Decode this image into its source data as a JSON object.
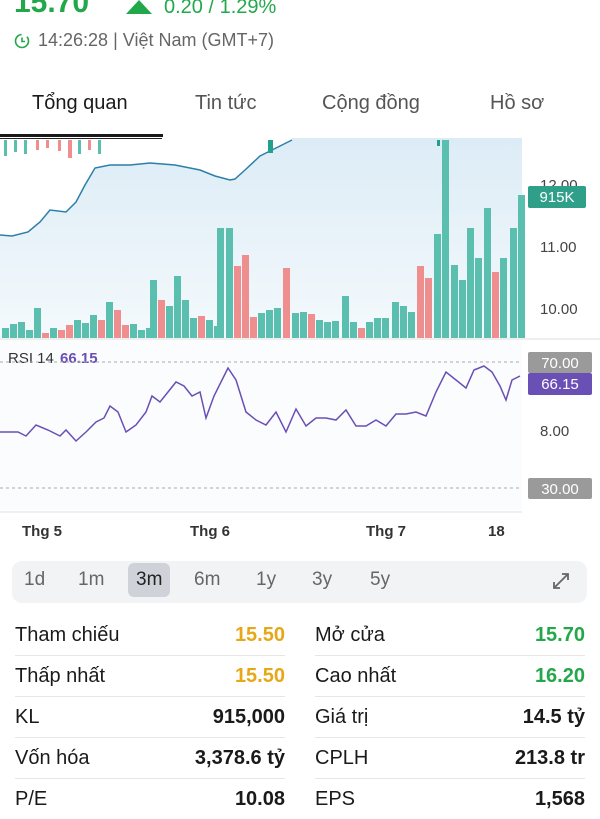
{
  "header": {
    "price": "15.70",
    "change": "0.20 / 1.29%",
    "time": "14:26:28",
    "timezone": "Việt Nam (GMT+7)"
  },
  "tabs": [
    {
      "label": "Tổng quan",
      "active": true
    },
    {
      "label": "Tin tức",
      "active": false
    },
    {
      "label": "Cộng đồng",
      "active": false
    },
    {
      "label": "Hồ sơ",
      "active": false
    }
  ],
  "chart_data": {
    "type": "bar",
    "price_axis": {
      "ticks": [
        "12.00",
        "11.00",
        "10.00",
        "8.00"
      ]
    },
    "volume_badge": "915K",
    "line_series": [
      [
        0,
        235
      ],
      [
        12,
        236
      ],
      [
        28,
        232
      ],
      [
        40,
        222
      ],
      [
        50,
        210
      ],
      [
        66,
        212
      ],
      [
        76,
        202
      ],
      [
        85,
        185
      ],
      [
        95,
        168
      ],
      [
        110,
        165
      ],
      [
        130,
        165
      ],
      [
        150,
        163
      ],
      [
        175,
        165
      ],
      [
        200,
        170
      ],
      [
        215,
        176
      ],
      [
        230,
        180
      ],
      [
        235,
        179
      ],
      [
        245,
        170
      ],
      [
        260,
        156
      ],
      [
        280,
        146
      ],
      [
        292,
        140
      ]
    ],
    "volume_bars": [
      {
        "x": 2,
        "top": 328,
        "color": "#5bbfb0"
      },
      {
        "x": 10,
        "top": 324,
        "color": "#5bbfb0"
      },
      {
        "x": 18,
        "top": 322,
        "color": "#5bbfb0"
      },
      {
        "x": 26,
        "top": 330,
        "color": "#5bbfb0"
      },
      {
        "x": 34,
        "top": 308,
        "color": "#5bbfb0"
      },
      {
        "x": 42,
        "top": 333,
        "color": "#ef8e8e"
      },
      {
        "x": 50,
        "top": 328,
        "color": "#5bbfb0"
      },
      {
        "x": 58,
        "top": 330,
        "color": "#ef8e8e"
      },
      {
        "x": 66,
        "top": 325,
        "color": "#ef8e8e"
      },
      {
        "x": 74,
        "top": 320,
        "color": "#5bbfb0"
      },
      {
        "x": 82,
        "top": 323,
        "color": "#5bbfb0"
      },
      {
        "x": 90,
        "top": 315,
        "color": "#5bbfb0"
      },
      {
        "x": 98,
        "top": 320,
        "color": "#ef8e8e"
      },
      {
        "x": 106,
        "top": 302,
        "color": "#5bbfb0"
      },
      {
        "x": 114,
        "top": 310,
        "color": "#ef8e8e"
      },
      {
        "x": 122,
        "top": 325,
        "color": "#ef8e8e"
      },
      {
        "x": 130,
        "top": 324,
        "color": "#5bbfb0"
      },
      {
        "x": 138,
        "top": 330,
        "color": "#5bbfb0"
      },
      {
        "x": 146,
        "top": 328,
        "color": "#5bbfb0"
      },
      {
        "x": 150,
        "top": 280,
        "color": "#5bbfb0"
      },
      {
        "x": 158,
        "top": 300,
        "color": "#ef8e8e"
      },
      {
        "x": 166,
        "top": 306,
        "color": "#5bbfb0"
      },
      {
        "x": 174,
        "top": 276,
        "color": "#5bbfb0"
      },
      {
        "x": 182,
        "top": 300,
        "color": "#5bbfb0"
      },
      {
        "x": 190,
        "top": 318,
        "color": "#5bbfb0"
      },
      {
        "x": 198,
        "top": 316,
        "color": "#ef8e8e"
      },
      {
        "x": 206,
        "top": 320,
        "color": "#5bbfb0"
      },
      {
        "x": 214,
        "top": 326,
        "color": "#5bbfb0"
      },
      {
        "x": 217,
        "top": 228,
        "color": "#5bbfb0"
      },
      {
        "x": 226,
        "top": 228,
        "color": "#5bbfb0"
      },
      {
        "x": 234,
        "top": 266,
        "color": "#ef8e8e"
      },
      {
        "x": 242,
        "top": 255,
        "color": "#ef8e8e"
      },
      {
        "x": 250,
        "top": 317,
        "color": "#ef8e8e"
      },
      {
        "x": 258,
        "top": 313,
        "color": "#5bbfb0"
      },
      {
        "x": 266,
        "top": 310,
        "color": "#5bbfb0"
      },
      {
        "x": 274,
        "top": 308,
        "color": "#5bbfb0"
      },
      {
        "x": 283,
        "top": 268,
        "color": "#ef8e8e"
      },
      {
        "x": 292,
        "top": 313,
        "color": "#5bbfb0"
      },
      {
        "x": 300,
        "top": 312,
        "color": "#5bbfb0"
      },
      {
        "x": 308,
        "top": 314,
        "color": "#ef8e8e"
      },
      {
        "x": 316,
        "top": 320,
        "color": "#5bbfb0"
      },
      {
        "x": 324,
        "top": 322,
        "color": "#5bbfb0"
      },
      {
        "x": 332,
        "top": 321,
        "color": "#5bbfb0"
      },
      {
        "x": 342,
        "top": 296,
        "color": "#5bbfb0"
      },
      {
        "x": 350,
        "top": 322,
        "color": "#5bbfb0"
      },
      {
        "x": 358,
        "top": 328,
        "color": "#ef8e8e"
      },
      {
        "x": 366,
        "top": 322,
        "color": "#5bbfb0"
      },
      {
        "x": 374,
        "top": 318,
        "color": "#5bbfb0"
      },
      {
        "x": 382,
        "top": 318,
        "color": "#5bbfb0"
      },
      {
        "x": 392,
        "top": 302,
        "color": "#5bbfb0"
      },
      {
        "x": 400,
        "top": 306,
        "color": "#5bbfb0"
      },
      {
        "x": 408,
        "top": 312,
        "color": "#5bbfb0"
      },
      {
        "x": 417,
        "top": 266,
        "color": "#ef8e8e"
      },
      {
        "x": 425,
        "top": 278,
        "color": "#ef8e8e"
      },
      {
        "x": 434,
        "top": 234,
        "color": "#5bbfb0"
      },
      {
        "x": 442,
        "top": 140,
        "color": "#5bbfb0"
      },
      {
        "x": 451,
        "top": 265,
        "color": "#5bbfb0"
      },
      {
        "x": 459,
        "top": 280,
        "color": "#5bbfb0"
      },
      {
        "x": 467,
        "top": 228,
        "color": "#5bbfb0"
      },
      {
        "x": 475,
        "top": 258,
        "color": "#5bbfb0"
      },
      {
        "x": 484,
        "top": 208,
        "color": "#5bbfb0"
      },
      {
        "x": 492,
        "top": 272,
        "color": "#ef8e8e"
      },
      {
        "x": 500,
        "top": 258,
        "color": "#5bbfb0"
      },
      {
        "x": 510,
        "top": 228,
        "color": "#5bbfb0"
      },
      {
        "x": 518,
        "top": 195,
        "color": "#5bbfb0"
      }
    ],
    "rsi": {
      "label": "RSI 14",
      "value": "66.15",
      "overbought": "70.00",
      "oversold": "30.00",
      "series": [
        [
          0,
          432
        ],
        [
          18,
          432
        ],
        [
          26,
          436
        ],
        [
          36,
          425
        ],
        [
          48,
          430
        ],
        [
          60,
          436
        ],
        [
          66,
          430
        ],
        [
          76,
          441
        ],
        [
          86,
          432
        ],
        [
          96,
          422
        ],
        [
          104,
          418
        ],
        [
          110,
          406
        ],
        [
          118,
          412
        ],
        [
          126,
          432
        ],
        [
          136,
          425
        ],
        [
          146,
          412
        ],
        [
          152,
          396
        ],
        [
          160,
          402
        ],
        [
          168,
          392
        ],
        [
          176,
          382
        ],
        [
          184,
          386
        ],
        [
          192,
          396
        ],
        [
          200,
          392
        ],
        [
          206,
          418
        ],
        [
          214,
          396
        ],
        [
          222,
          380
        ],
        [
          228,
          368
        ],
        [
          236,
          380
        ],
        [
          246,
          412
        ],
        [
          256,
          420
        ],
        [
          266,
          425
        ],
        [
          276,
          412
        ],
        [
          286,
          432
        ],
        [
          296,
          409
        ],
        [
          306,
          426
        ],
        [
          316,
          418
        ],
        [
          326,
          418
        ],
        [
          336,
          420
        ],
        [
          346,
          410
        ],
        [
          356,
          426
        ],
        [
          366,
          426
        ],
        [
          376,
          420
        ],
        [
          386,
          426
        ],
        [
          396,
          414
        ],
        [
          406,
          414
        ],
        [
          416,
          412
        ],
        [
          426,
          416
        ],
        [
          436,
          392
        ],
        [
          446,
          372
        ],
        [
          456,
          380
        ],
        [
          466,
          388
        ],
        [
          474,
          370
        ],
        [
          484,
          366
        ],
        [
          492,
          372
        ],
        [
          500,
          386
        ],
        [
          506,
          400
        ],
        [
          512,
          380
        ],
        [
          520,
          376
        ]
      ]
    },
    "x_ticks": [
      "Thg 5",
      "Thg 6",
      "Thg 7",
      "18"
    ]
  },
  "range": {
    "options": [
      "1d",
      "1m",
      "3m",
      "6m",
      "1y",
      "3y",
      "5y"
    ],
    "selected": "3m"
  },
  "stats": {
    "left": [
      {
        "label": "Tham chiếu",
        "value": "15.50",
        "color": "#e6a817"
      },
      {
        "label": "Thấp nhất",
        "value": "15.50",
        "color": "#e6a817"
      },
      {
        "label": "KL",
        "value": "915,000",
        "color": "#1a1a1a"
      },
      {
        "label": "Vốn hóa",
        "value": "3,378.6 tỷ",
        "color": "#1a1a1a"
      },
      {
        "label": "P/E",
        "value": "10.08",
        "color": "#1a1a1a"
      }
    ],
    "right": [
      {
        "label": "Mở cửa",
        "value": "15.70",
        "color": "#22a84a"
      },
      {
        "label": "Cao nhất",
        "value": "16.20",
        "color": "#22a84a"
      },
      {
        "label": "Giá trị",
        "value": "14.5 tỷ",
        "color": "#1a1a1a"
      },
      {
        "label": "CPLH",
        "value": "213.8 tr",
        "color": "#1a1a1a"
      },
      {
        "label": "EPS",
        "value": "1,568",
        "color": "#1a1a1a"
      }
    ]
  }
}
